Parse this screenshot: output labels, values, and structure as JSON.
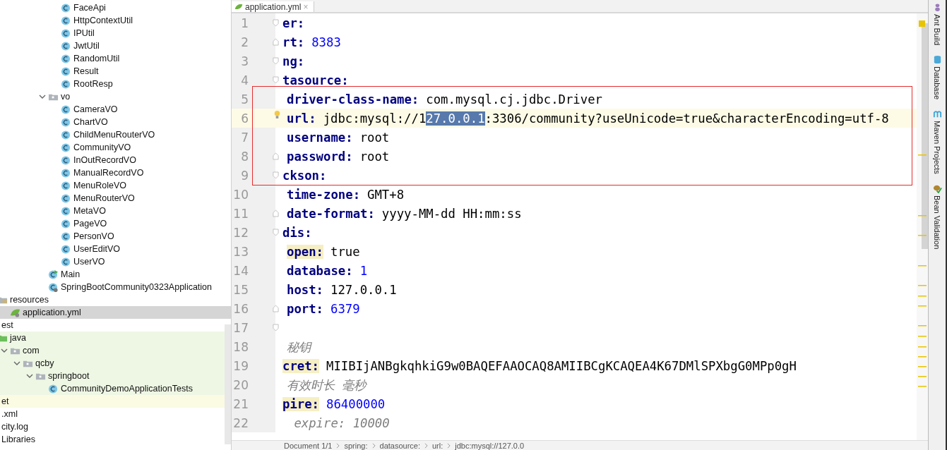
{
  "project_tree": [
    {
      "children": [
        {
          "children": [
            {
              "children": [
                {
                  "children": [
                    {
                      "children": [
                        {
                          "children": [
                            {
                              "label": "FaceApi",
                              "kind": "class"
                            },
                            {
                              "label": "HttpContextUtil",
                              "kind": "class"
                            },
                            {
                              "label": "IPUtil",
                              "kind": "class"
                            },
                            {
                              "label": "JwtUtil",
                              "kind": "class"
                            },
                            {
                              "label": "RandomUtil",
                              "kind": "class"
                            },
                            {
                              "label": "Result",
                              "kind": "class"
                            },
                            {
                              "label": "RootResp",
                              "kind": "class"
                            }
                          ]
                        },
                        {
                          "label": "vo",
                          "kind": "folder",
                          "expanded": true,
                          "children": [
                            {
                              "label": "CameraVO",
                              "kind": "class"
                            },
                            {
                              "label": "ChartVO",
                              "kind": "class"
                            },
                            {
                              "label": "ChildMenuRouterVO",
                              "kind": "class"
                            },
                            {
                              "label": "CommunityVO",
                              "kind": "class"
                            },
                            {
                              "label": "InOutRecordVO",
                              "kind": "class"
                            },
                            {
                              "label": "ManualRecordVO",
                              "kind": "class"
                            },
                            {
                              "label": "MenuRoleVO",
                              "kind": "class"
                            },
                            {
                              "label": "MenuRouterVO",
                              "kind": "class"
                            },
                            {
                              "label": "MetaVO",
                              "kind": "class"
                            },
                            {
                              "label": "PageVO",
                              "kind": "class"
                            },
                            {
                              "label": "PersonVO",
                              "kind": "class"
                            },
                            {
                              "label": "UserEditVO",
                              "kind": "class"
                            },
                            {
                              "label": "UserVO",
                              "kind": "class"
                            }
                          ]
                        },
                        {
                          "label": "Main",
                          "kind": "main-class"
                        },
                        {
                          "label": "SpringBootCommunity0323Application",
                          "kind": "spring-class"
                        }
                      ]
                    }
                  ]
                }
              ]
            }
          ]
        },
        {
          "label": "resources",
          "kind": "resources-folder",
          "children": [
            {
              "label": "application.yml",
              "kind": "yml",
              "selected": true
            }
          ]
        }
      ]
    },
    {
      "label": "est",
      "children": [
        {
          "label": "java",
          "kind": "source-folder",
          "test_source": true,
          "children": [
            {
              "label": "com",
              "kind": "folder",
              "test_source": true,
              "expanded": true,
              "children": [
                {
                  "label": "qcby",
                  "kind": "folder",
                  "test_source": true,
                  "expanded": true,
                  "children": [
                    {
                      "label": "springboot",
                      "kind": "folder",
                      "test_source": true,
                      "expanded": true,
                      "children": [
                        {
                          "label": "CommunityDemoApplicationTests",
                          "kind": "class",
                          "test_source": true
                        }
                      ]
                    }
                  ]
                }
              ]
            }
          ]
        }
      ]
    },
    {
      "label": "et",
      "excluded": true
    },
    {
      "label": ".xml"
    },
    {
      "label": "city.log"
    },
    {
      "label": "Libraries"
    }
  ],
  "editor": {
    "tab": {
      "title": "application.yml",
      "close": "×"
    },
    "lines": [
      {
        "number": "1",
        "indent": false,
        "fold_start": true,
        "key": "er:"
      },
      {
        "number": "2",
        "indent": false,
        "fold_end": true,
        "key": "rt:",
        "value": [
          {
            "text": "8383",
            "kind": "number"
          }
        ]
      },
      {
        "number": "3",
        "indent": false,
        "fold_start": true,
        "key": "ng:"
      },
      {
        "number": "4",
        "indent": false,
        "fold_start": true,
        "key": "tasource:"
      },
      {
        "number": "5",
        "indent": true,
        "key": "driver-class-name:",
        "value": [
          {
            "text": "com.mysql.cj.jdbc.Driver",
            "kind": "string"
          }
        ]
      },
      {
        "number": "6",
        "indent": true,
        "current": true,
        "bulb": true,
        "key": "url:",
        "value": [
          {
            "text": "jdbc:mysql://1",
            "kind": "string"
          },
          {
            "text": "27.0.0.1",
            "kind": "selection"
          },
          {
            "text": ":3306/community?useUnicode=true&characterEncoding=utf-8",
            "kind": "string"
          }
        ]
      },
      {
        "number": "7",
        "indent": true,
        "key": "username:",
        "value": [
          {
            "text": "root",
            "kind": "string"
          }
        ]
      },
      {
        "number": "8",
        "indent": true,
        "fold_end": true,
        "key": "password:",
        "value": [
          {
            "text": "root",
            "kind": "string"
          }
        ]
      },
      {
        "number": "9",
        "indent": false,
        "fold_start": true,
        "key": "ckson:"
      },
      {
        "number": "10",
        "indent": true,
        "key": "time-zone:",
        "value": [
          {
            "text": "GMT+8",
            "kind": "string"
          }
        ]
      },
      {
        "number": "11",
        "indent": true,
        "fold_end": true,
        "key": "date-format:",
        "value": [
          {
            "text": "yyyy-MM-dd HH:mm:ss",
            "kind": "string"
          }
        ]
      },
      {
        "number": "12",
        "indent": false,
        "fold_start": true,
        "key": "dis:"
      },
      {
        "number": "13",
        "indent": true,
        "key_marked": true,
        "key": "open:",
        "value": [
          {
            "text": "true",
            "kind": "string"
          }
        ]
      },
      {
        "number": "14",
        "indent": true,
        "key": "database:",
        "value": [
          {
            "text": "1",
            "kind": "number"
          }
        ]
      },
      {
        "number": "15",
        "indent": true,
        "key": "host:",
        "value": [
          {
            "text": "127.0.0.1",
            "kind": "string"
          }
        ]
      },
      {
        "number": "16",
        "indent": true,
        "fold_end": true,
        "key": "port:",
        "value": [
          {
            "text": "6379",
            "kind": "number"
          }
        ]
      },
      {
        "number": "17",
        "fold_start": true
      },
      {
        "number": "18",
        "indent": true,
        "comment": "秘钥"
      },
      {
        "number": "19",
        "indent": false,
        "key_marked": true,
        "key": "cret:",
        "value": [
          {
            "text": "MIIBIjANBgkqhkiG9w0BAQEFAAOCAQ8AMIIBCgKCAQEA4K67DMlSPXbgG0MPp0gH",
            "kind": "string"
          }
        ]
      },
      {
        "number": "20",
        "indent": true,
        "comment": "有效时长 毫秒"
      },
      {
        "number": "21",
        "indent": false,
        "key_marked": true,
        "key": "pire:",
        "value": [
          {
            "text": "86400000",
            "kind": "number"
          }
        ]
      },
      {
        "number": "22",
        "indent": true,
        "comment": " expire: 10000"
      }
    ],
    "annotation": {
      "kind": "rectangle"
    },
    "breadcrumbs": [
      "Document 1/1",
      "spring:",
      "datasource:",
      "url:",
      "jdbc:mysql://127.0.0"
    ]
  },
  "tool_strip": [
    {
      "label": "Ant Build",
      "kind": "ant"
    },
    {
      "label": "Database",
      "kind": "database"
    },
    {
      "label": "Maven Projects",
      "kind": "maven"
    },
    {
      "label": "Bean Validation",
      "kind": "bean"
    }
  ]
}
